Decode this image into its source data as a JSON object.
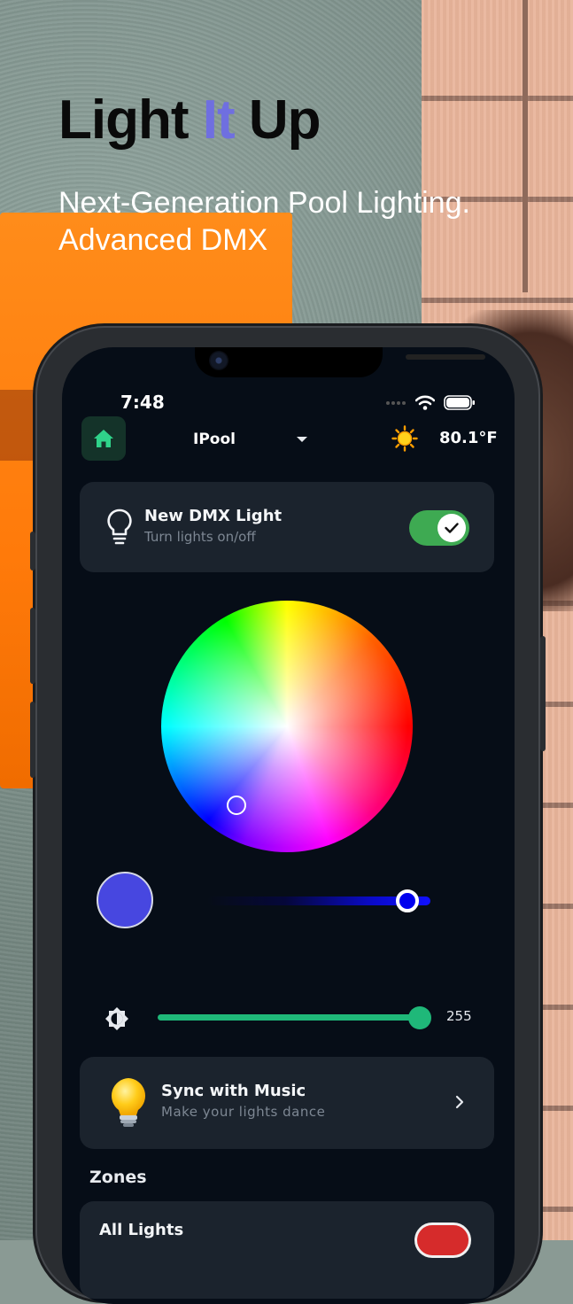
{
  "headline": {
    "part1": "Light",
    "part2": "It",
    "part3": "Up"
  },
  "subheading": {
    "line1": "Next-Generation Pool Lighting.",
    "line2": "Advanced DMX"
  },
  "status_bar": {
    "time": "7:48"
  },
  "header": {
    "pool_name": "IPool",
    "temperature": "80.1°F"
  },
  "light_card": {
    "title": "New DMX Light",
    "subtitle": "Turn lights on/off",
    "toggle_on": true
  },
  "color": {
    "selected_hex": "#4747e0"
  },
  "brightness": {
    "value": "255",
    "max": 255
  },
  "music_card": {
    "title": "Sync with Music",
    "subtitle": "Make your lights dance"
  },
  "zones": {
    "label": "Zones",
    "items": [
      {
        "name": "All Lights"
      }
    ]
  },
  "colors": {
    "accent_green": "#1fb879",
    "toggle_green": "#3eaa52",
    "headline_accent": "#6f6fe0"
  },
  "icons": [
    "home-icon",
    "caret-down-icon",
    "sun-icon",
    "lightbulb-icon",
    "check-icon",
    "brightness-icon",
    "bulb-emoji-icon",
    "chevron-right-icon",
    "wifi-icon",
    "battery-icon"
  ]
}
